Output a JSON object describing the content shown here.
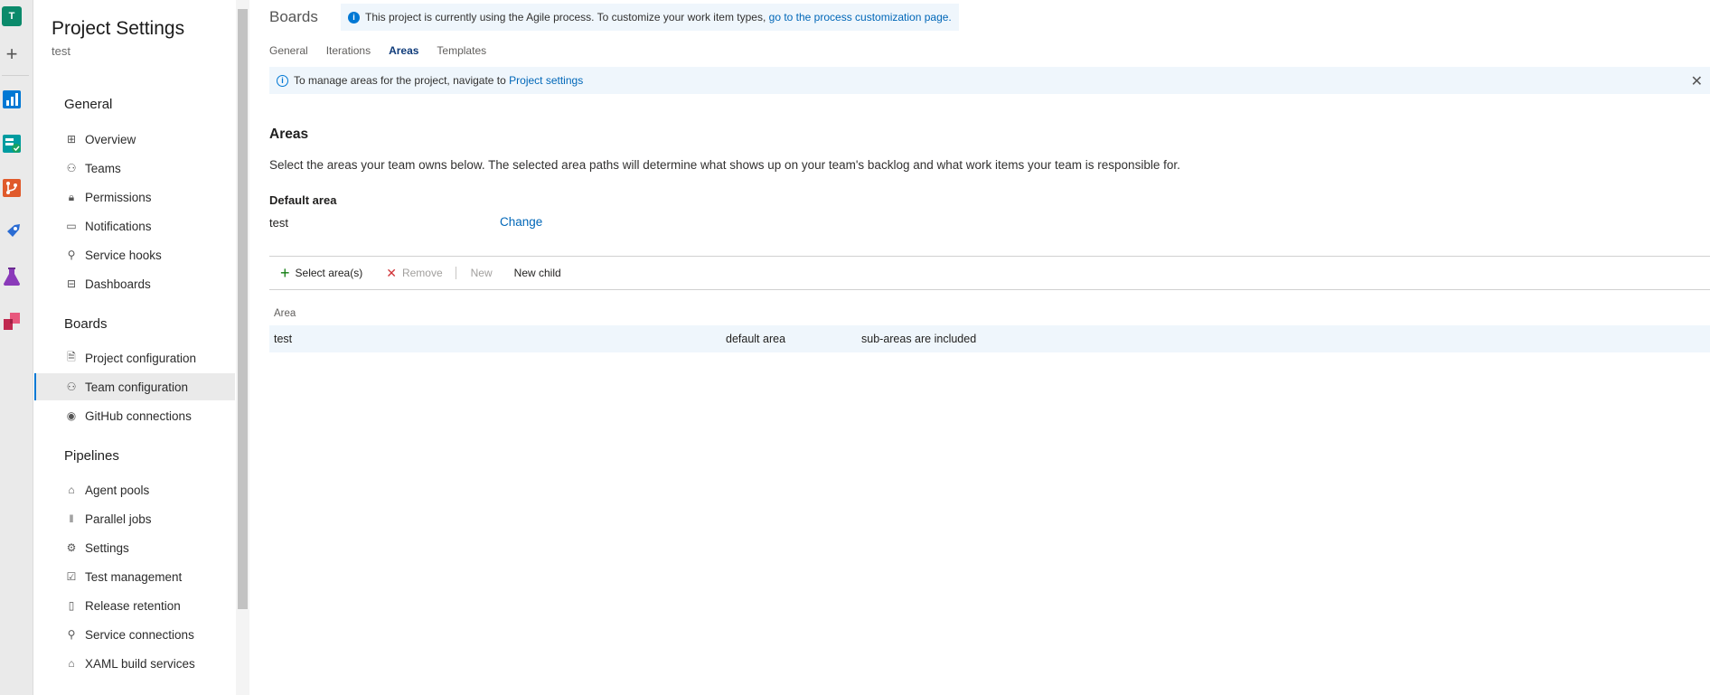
{
  "rail": {
    "avatar": "T",
    "icons": [
      "plus-icon",
      "boards-app-icon",
      "repos-app-icon",
      "pipelines-app-icon",
      "test-plans-app-icon",
      "artifacts-app-icon"
    ]
  },
  "nav": {
    "title": "Project Settings",
    "project": "test",
    "sections": [
      {
        "heading": "General",
        "items": [
          {
            "label": "Overview",
            "icon": "overview-icon"
          },
          {
            "label": "Teams",
            "icon": "teams-icon"
          },
          {
            "label": "Permissions",
            "icon": "lock-icon"
          },
          {
            "label": "Notifications",
            "icon": "comment-icon"
          },
          {
            "label": "Service hooks",
            "icon": "plug-icon"
          },
          {
            "label": "Dashboards",
            "icon": "dashboard-icon"
          }
        ]
      },
      {
        "heading": "Boards",
        "items": [
          {
            "label": "Project configuration",
            "icon": "document-icon"
          },
          {
            "label": "Team configuration",
            "icon": "team-config-icon",
            "active": true
          },
          {
            "label": "GitHub connections",
            "icon": "github-icon"
          }
        ]
      },
      {
        "heading": "Pipelines",
        "items": [
          {
            "label": "Agent pools",
            "icon": "agent-pool-icon"
          },
          {
            "label": "Parallel jobs",
            "icon": "parallel-icon"
          },
          {
            "label": "Settings",
            "icon": "gear-icon"
          },
          {
            "label": "Test management",
            "icon": "test-icon"
          },
          {
            "label": "Release retention",
            "icon": "phone-icon"
          },
          {
            "label": "Service connections",
            "icon": "plug-icon"
          },
          {
            "label": "XAML build services",
            "icon": "build-icon"
          }
        ]
      }
    ]
  },
  "main": {
    "breadcrumb": "Boards",
    "process_info": {
      "text": "This project is currently using the Agile process. To customize your work item types,",
      "link": "go to the process customization page."
    },
    "tabs": [
      {
        "label": "General"
      },
      {
        "label": "Iterations"
      },
      {
        "label": "Areas",
        "active": true
      },
      {
        "label": "Templates"
      }
    ],
    "banner": {
      "text": "To manage areas for the project, navigate to",
      "link": "Project settings",
      "close": "✕"
    },
    "areas_title": "Areas",
    "areas_desc": "Select the areas your team owns below. The selected area paths will determine what shows up on your team's backlog and what work items your team is responsible for.",
    "default_area": {
      "label": "Default area",
      "value": "test",
      "change": "Change"
    },
    "toolbar": {
      "select": "Select area(s)",
      "remove": "Remove",
      "new": "New",
      "new_child": "New child"
    },
    "grid": {
      "header": "Area",
      "rows": [
        {
          "area": "test",
          "default": "default area",
          "subareas": "sub-areas are included"
        }
      ]
    }
  }
}
